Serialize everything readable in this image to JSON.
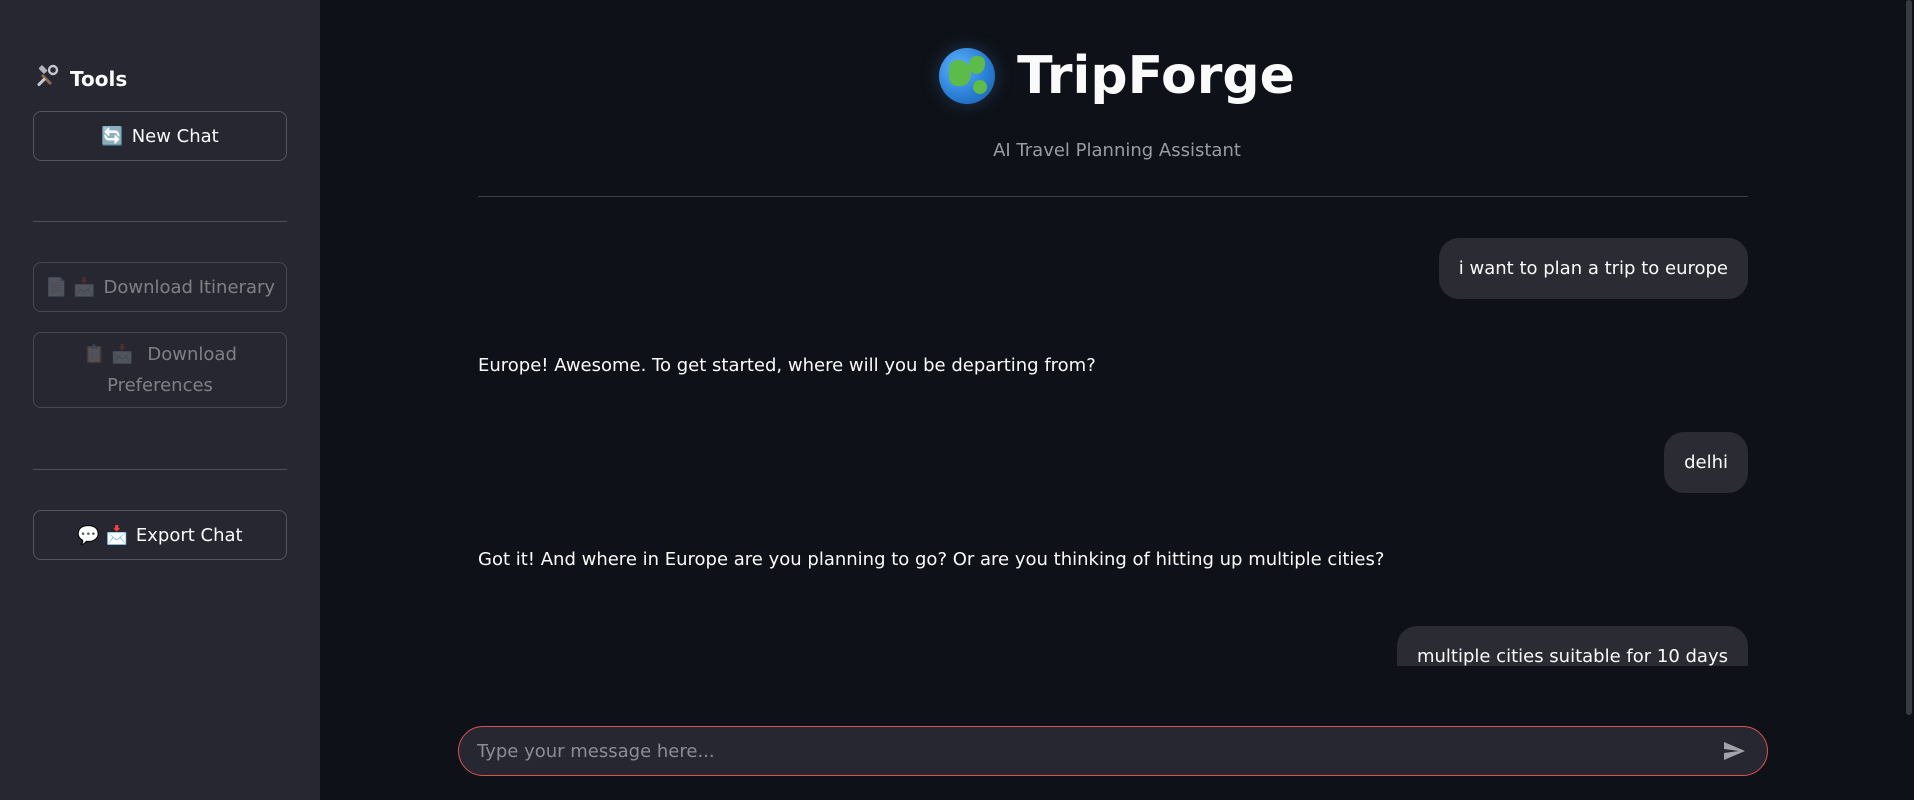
{
  "sidebar": {
    "title": "Tools",
    "title_icon": "hammer-wrench-icon",
    "new_chat": {
      "icon": "🔄",
      "label": "New Chat"
    },
    "download_itinerary": {
      "icons": "📄 📩",
      "label": "Download Itinerary"
    },
    "download_preferences": {
      "icons": "📋 📩",
      "label_line1": "Download",
      "label_line2": "Preferences"
    },
    "export_chat": {
      "icons": "💬 📩",
      "label": "Export Chat"
    }
  },
  "header": {
    "title": "TripForge",
    "globe_icon": "globe-icon",
    "subtitle": "AI Travel Planning Assistant"
  },
  "messages": [
    {
      "role": "user",
      "text": "i want to plan a trip to europe"
    },
    {
      "role": "assistant",
      "text": "Europe! Awesome. To get started, where will you be departing from?"
    },
    {
      "role": "user",
      "text": "delhi"
    },
    {
      "role": "assistant",
      "text": "Got it! And where in Europe are you planning to go? Or are you thinking of hitting up multiple cities?"
    },
    {
      "role": "user",
      "text": "multiple cities suitable for 10 days"
    }
  ],
  "chat_input": {
    "placeholder": "Type your message here...",
    "value": "",
    "send_icon": "send-icon"
  },
  "colors": {
    "background": "#0e1117",
    "sidebar": "#262730",
    "input_border": "#d9534f",
    "user_bubble": "#2b2c33"
  }
}
